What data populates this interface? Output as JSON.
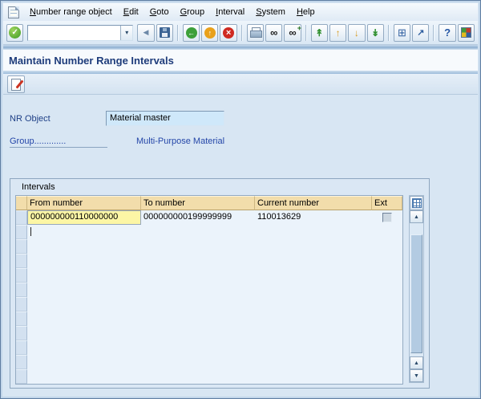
{
  "window": {
    "screen_title": "Maintain Number Range Intervals"
  },
  "menu_bar": {
    "items": [
      "Number range object",
      "Edit",
      "Goto",
      "Group",
      "Interval",
      "System",
      "Help"
    ]
  },
  "toolbar": {
    "command_field": {
      "value": ""
    },
    "icons": [
      "enter-icon",
      "command-collapse-icon",
      "save-icon",
      "back-icon",
      "exit-icon",
      "cancel-icon",
      "print-icon",
      "find-icon",
      "find-next-icon",
      "first-page-icon",
      "previous-page-icon",
      "next-page-icon",
      "last-page-icon",
      "new-session-icon",
      "create-shortcut-icon",
      "help-icon",
      "customize-layout-icon"
    ]
  },
  "app_toolbar": {
    "icons": [
      "display-change-icon"
    ]
  },
  "form": {
    "nr_object": {
      "label": "NR Object",
      "value": "Material master"
    },
    "group": {
      "label": "Group.............",
      "value": "Multi-Purpose Material"
    }
  },
  "intervals": {
    "box_title": "Intervals",
    "columns": {
      "from": "From number",
      "to": "To number",
      "current": "Current number",
      "ext": "Ext"
    },
    "rows": [
      {
        "from": "000000000110000000",
        "to": "000000000199999999",
        "current": "110013629",
        "ext": false
      }
    ],
    "visible_empty_rows": 11,
    "table_config_icon": "table-settings-grid-icon",
    "scrollbar_icons": [
      "scroll-up-icon",
      "scroll-down-icon"
    ]
  }
}
